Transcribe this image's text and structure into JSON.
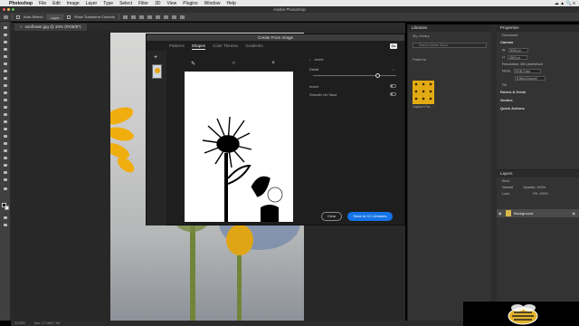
{
  "menubar": {
    "app_name": "Photoshop",
    "items": [
      "File",
      "Edit",
      "Image",
      "Layer",
      "Type",
      "Select",
      "Filter",
      "3D",
      "View",
      "Plugins",
      "Window",
      "Help"
    ],
    "status_icons": "☁ ▲ 🔍 ≡"
  },
  "window": {
    "title": "Adobe Photoshop"
  },
  "options": {
    "auto_select_label": "Auto-Select:",
    "auto_select_value": "Layer",
    "show_transform_label": "Show Transform Controls"
  },
  "document": {
    "tab_title": "sunflower.jpg @ 33% (RGB/8*)"
  },
  "status": {
    "zoom": "33.33%",
    "doc_info": "Doc: 17.1M/17.1M"
  },
  "dialog": {
    "title": "Create From Image",
    "tabs": [
      "Patterns",
      "Shapes",
      "Color Themes",
      "Gradients"
    ],
    "active_tab": "Shapes",
    "cc_label": "Cc",
    "invert_label": "Invert",
    "detail_label": "Detail",
    "invert_toggle_label": "Invert",
    "smooth_label": "Smooth On Save",
    "clear_label": "Clear",
    "save_label": "Save to CC Libraries",
    "slider_value": 0.78
  },
  "libraries": {
    "title": "Libraries",
    "subtitle": "My Library",
    "search_placeholder": "Search Adobe Stock",
    "section": "Patterns",
    "pattern_caption": "Capture Pat..."
  },
  "properties": {
    "title": "Properties",
    "doc_label": "Document",
    "canvas_header": "Canvas",
    "width": "3000 px",
    "height": "4500 px",
    "resolution": "Resolution: 300 pixels/inch",
    "mode_label": "Mode",
    "mode_value": "RGB Color",
    "depth_value": "8 Bits/Channel",
    "fill_label": "Fill",
    "rulers": "Rulers & Grids",
    "guides": "Guides",
    "quick_actions": "Quick Actions"
  },
  "layers": {
    "title": "Layers",
    "kind_label": "Kind",
    "blend_mode": "Normal",
    "opacity_label": "Opacity:",
    "opacity_value": "100%",
    "lock_label": "Lock:",
    "fill_label": "Fill:",
    "fill_value": "100%",
    "background_layer": "Background"
  }
}
